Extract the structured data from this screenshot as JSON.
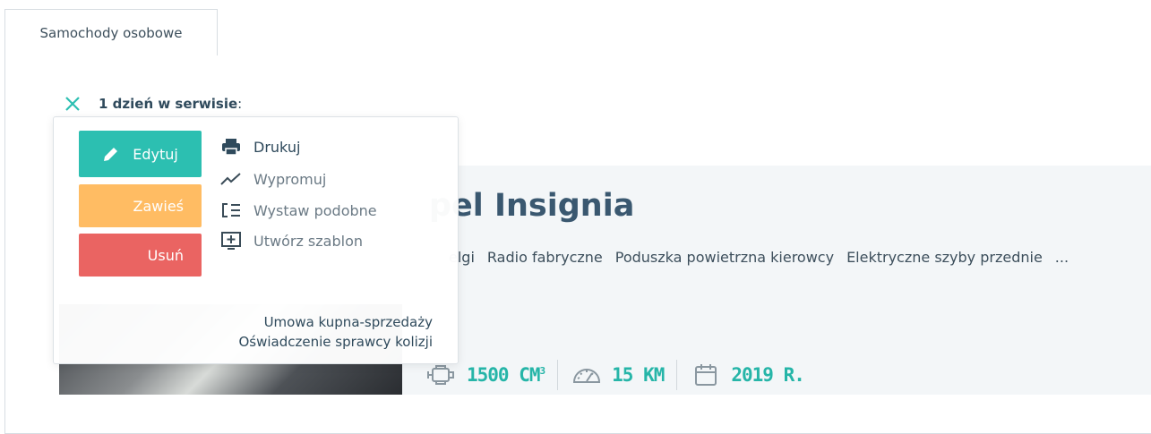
{
  "tabs": [
    {
      "label": "Samochody osobowe"
    }
  ],
  "service": {
    "label": "1 dzień w serwisie",
    "colon": ":"
  },
  "popup": {
    "buttons": {
      "edit": "Edytuj",
      "suspend": "Zawieś",
      "delete": "Usuń"
    },
    "actions": {
      "print": "Drukuj",
      "promote": "Wypromuj",
      "similar": "Wystaw podobne",
      "template": "Utwórz szablon"
    },
    "documents": {
      "contract": "Umowa kupna-sprzedaży",
      "statement": "Oświadczenie sprawcy kolizji"
    }
  },
  "listing": {
    "title": "pel Insignia",
    "features": [
      "elgi",
      "Radio fabryczne",
      "Poduszka powietrzna kierowcy",
      "Elektryczne szyby przednie",
      "..."
    ],
    "specs": {
      "engine": "1500 CM",
      "engine_sup": "3",
      "mileage": "15 KM",
      "year": "2019 R."
    }
  },
  "colors": {
    "accent": "#2cbfb1",
    "suspend": "#ffbc63",
    "delete": "#ea6462",
    "title": "#3a5870"
  },
  "icons": [
    "close-icon",
    "pencil-icon",
    "print-icon",
    "trend-icon",
    "list-icon",
    "add-template-icon",
    "engine-icon",
    "speedometer-icon",
    "calendar-icon"
  ]
}
